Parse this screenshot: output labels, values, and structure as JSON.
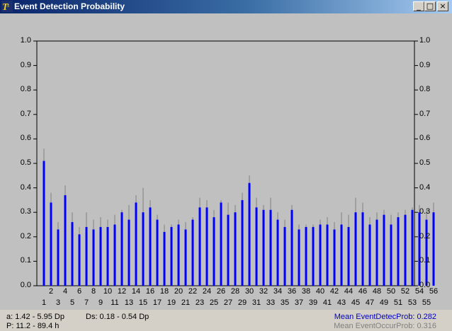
{
  "window": {
    "title": "Event Detection Probability",
    "minimize_glyph": "_",
    "maximize_glyph": "□",
    "close_glyph": "×"
  },
  "status": {
    "a_range": "a: 1.42 - 5.95 Dp",
    "ds_range": "Ds: 0.18 - 0.54 Dp",
    "p_range": "P: 11.2 - 89.4 h",
    "mean_detec": "Mean EventDetecProb: 0.282",
    "mean_occur": "Mean EventOccurProb: 0.316"
  },
  "colors": {
    "bar": "#0000ff",
    "whisker": "#808080",
    "plot_bg": "#c0c0c0",
    "mean_detec": "#0000c0",
    "mean_occur": "#808080"
  },
  "chart_data": {
    "type": "bar",
    "ylim": [
      0,
      1
    ],
    "y_ticks": [
      "0.0",
      "0.1",
      "0.2",
      "0.3",
      "0.4",
      "0.5",
      "0.6",
      "0.7",
      "0.8",
      "0.9",
      "1.0"
    ],
    "categories": [
      "1",
      "2",
      "3",
      "4",
      "5",
      "6",
      "7",
      "8",
      "9",
      "10",
      "11",
      "12",
      "13",
      "14",
      "15",
      "16",
      "17",
      "18",
      "19",
      "20",
      "21",
      "22",
      "23",
      "24",
      "25",
      "26",
      "27",
      "28",
      "29",
      "30",
      "31",
      "32",
      "33",
      "34",
      "35",
      "36",
      "37",
      "38",
      "39",
      "40",
      "41",
      "42",
      "43",
      "44",
      "45",
      "46",
      "47",
      "48",
      "49",
      "50",
      "51",
      "52",
      "53",
      "54",
      "55",
      "56"
    ],
    "series": [
      {
        "values": [
          0.51,
          0.34,
          0.23,
          0.37,
          0.26,
          0.21,
          0.24,
          0.23,
          0.24,
          0.24,
          0.25,
          0.3,
          0.27,
          0.34,
          0.3,
          0.32,
          0.27,
          0.22,
          0.24,
          0.25,
          0.23,
          0.27,
          0.32,
          0.32,
          0.28,
          0.34,
          0.29,
          0.3,
          0.35,
          0.42,
          0.32,
          0.31,
          0.31,
          0.27,
          0.24,
          0.31,
          0.23,
          0.24,
          0.24,
          0.25,
          0.25,
          0.23,
          0.25,
          0.24,
          0.3,
          0.3,
          0.25,
          0.27,
          0.29,
          0.25,
          0.28,
          0.29,
          0.31,
          0.3,
          0.27,
          0.3
        ]
      },
      {
        "values": [
          0.56,
          0.38,
          0.26,
          0.41,
          0.3,
          0.24,
          0.3,
          0.27,
          0.28,
          0.27,
          0.29,
          0.31,
          0.33,
          0.37,
          0.4,
          0.35,
          0.29,
          0.25,
          0.25,
          0.27,
          0.26,
          0.28,
          0.36,
          0.35,
          0.31,
          0.35,
          0.34,
          0.33,
          0.38,
          0.45,
          0.36,
          0.33,
          0.36,
          0.3,
          0.27,
          0.33,
          0.25,
          0.25,
          0.25,
          0.27,
          0.28,
          0.26,
          0.3,
          0.29,
          0.36,
          0.34,
          0.28,
          0.3,
          0.31,
          0.29,
          0.3,
          0.31,
          0.32,
          0.33,
          0.31,
          0.34
        ]
      }
    ]
  }
}
